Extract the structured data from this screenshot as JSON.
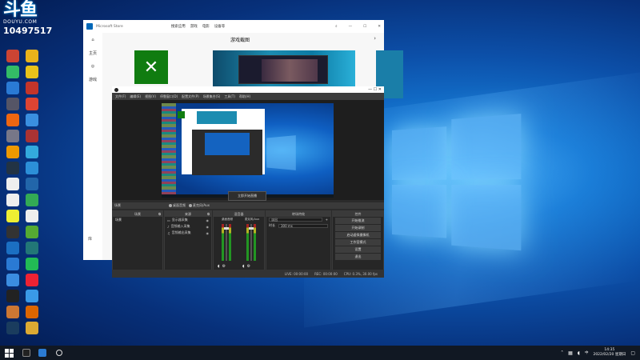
{
  "watermark": {
    "logo": "斗鱼",
    "site": "DOUYU.COM",
    "room_id": "10497517"
  },
  "desktop": {
    "icons": [
      {
        "name": "icon-1",
        "color": "#c43"
      },
      {
        "name": "icon-2",
        "color": "#e8b21a"
      },
      {
        "name": "icon-3",
        "color": "#3b6"
      },
      {
        "name": "icon-4",
        "color": "#e8c21a"
      },
      {
        "name": "icon-5",
        "color": "#2a7ad4"
      },
      {
        "name": "icon-6",
        "color": "#c4352a"
      },
      {
        "name": "icon-7",
        "color": "#556"
      },
      {
        "name": "icon-8",
        "color": "#d43"
      },
      {
        "name": "icon-9",
        "color": "#e61"
      },
      {
        "name": "icon-10",
        "color": "#3a8fe0"
      },
      {
        "name": "icon-11",
        "color": "#778"
      },
      {
        "name": "icon-12",
        "color": "#a33"
      },
      {
        "name": "icon-13",
        "color": "#e90"
      },
      {
        "name": "icon-14",
        "color": "#3ad"
      },
      {
        "name": "icon-15",
        "color": "#234"
      },
      {
        "name": "icon-16",
        "color": "#2c8fd8"
      },
      {
        "name": "icon-17",
        "color": "#eee"
      },
      {
        "name": "icon-18",
        "color": "#26a"
      },
      {
        "name": "icon-19",
        "color": "#eee"
      },
      {
        "name": "icon-20",
        "color": "#3a5"
      },
      {
        "name": "icon-21",
        "color": "#ee3"
      },
      {
        "name": "icon-22",
        "color": "#eee"
      },
      {
        "name": "icon-23",
        "color": "#333"
      },
      {
        "name": "icon-24",
        "color": "#5a3"
      },
      {
        "name": "icon-25",
        "color": "#1b6fc2"
      },
      {
        "name": "icon-26",
        "color": "#277"
      },
      {
        "name": "icon-27",
        "color": "#2a7ad4"
      },
      {
        "name": "icon-28",
        "color": "#2b5"
      },
      {
        "name": "icon-29",
        "color": "#3b8de0"
      },
      {
        "name": "icon-30",
        "color": "#e23"
      },
      {
        "name": "icon-31",
        "color": "#222"
      },
      {
        "name": "icon-32",
        "color": "#3a9ae8"
      },
      {
        "name": "icon-33",
        "color": "#c73"
      },
      {
        "name": "icon-34",
        "color": "#d60"
      },
      {
        "name": "icon-35",
        "color": "#1a3c5e"
      },
      {
        "name": "icon-36",
        "color": "#da3"
      }
    ]
  },
  "store": {
    "title": "Microsoft Store",
    "nav": [
      "搜索应用",
      "游戏",
      "电影",
      "设备等"
    ],
    "heading": "游戏截图",
    "side_home": "主页",
    "side_games": "游戏",
    "bottom_label": "库"
  },
  "obs": {
    "menu": [
      "文件(F)",
      "编辑(E)",
      "视图(V)",
      "停靠窗口(D)",
      "配置文件(P)",
      "场景集合(S)",
      "工具(T)",
      "帮助(H)"
    ],
    "toast": "立即开始直播",
    "panels": {
      "scenes": "场景",
      "sources": "来源",
      "mixer": "混音器",
      "transitions": "转场特效",
      "controls": "控件"
    },
    "scene_item": "场景",
    "sources": [
      "显示器采集",
      "音频输入采集",
      "音频输出采集"
    ],
    "mixer_channels": [
      "桌面音频",
      "麦克风/Aux"
    ],
    "transitions": {
      "type_label": "淡出",
      "duration_label": "时长",
      "duration": "300 ms"
    },
    "controls": [
      "开始推流",
      "开始录制",
      "启动虚拟摄像机",
      "工作室模式",
      "设置",
      "退出"
    ],
    "status": [
      "LIVE: 00:00:00",
      "REC: 00:00:00",
      "CPU: 0.3%, 30.00 fps"
    ]
  },
  "taskbar": {
    "time": "14:35",
    "date": "2022/02/20 星期日",
    "lang": "中"
  }
}
